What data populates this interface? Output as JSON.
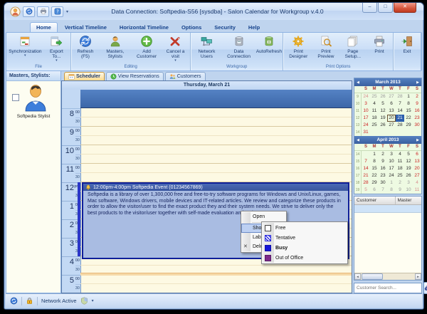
{
  "window": {
    "title": "Data Connection: Softpedia-S56 [sysdba] - Salon Calendar for Workgroup v.4.0",
    "controls": {
      "minimize": "–",
      "maximize": "□",
      "close": "✕"
    }
  },
  "ribbon": {
    "tabs": [
      {
        "label": "Home",
        "active": true
      },
      {
        "label": "Vertical Timeline"
      },
      {
        "label": "Horizontal Timeline"
      },
      {
        "label": "Options"
      },
      {
        "label": "Security"
      },
      {
        "label": "Help"
      }
    ],
    "groups": [
      {
        "label": "File",
        "buttons": [
          {
            "label": "Synchronization",
            "icon": "sync",
            "arrow": true
          },
          {
            "label": "Export To...",
            "icon": "export",
            "arrow": true
          }
        ]
      },
      {
        "label": "Editing",
        "buttons": [
          {
            "label": "Refresh (F5)",
            "icon": "refresh"
          },
          {
            "label": "Masters, Stylists",
            "icon": "masters"
          },
          {
            "label": "Add Customer",
            "icon": "add-customer"
          },
          {
            "label": "Cancel a visit",
            "icon": "cancel-visit",
            "arrow": true
          }
        ]
      },
      {
        "label": "Workgroup",
        "buttons": [
          {
            "label": "Network Users",
            "icon": "network-users"
          },
          {
            "label": "Data Connection",
            "icon": "data-connection"
          },
          {
            "label": "AutoRefresh",
            "icon": "autorefresh"
          }
        ]
      },
      {
        "label": "Print Options",
        "buttons": [
          {
            "label": "Print Designer",
            "icon": "print-designer"
          },
          {
            "label": "Print Preview",
            "icon": "print-preview"
          },
          {
            "label": "Page Setup...",
            "icon": "page-setup"
          },
          {
            "label": "Print",
            "icon": "print"
          }
        ]
      },
      {
        "label": "",
        "buttons": [
          {
            "label": "Exit",
            "icon": "exit"
          }
        ]
      }
    ]
  },
  "sidebar": {
    "header": "Masters, Stylists:",
    "stylist_name": "Softpedia Stylist"
  },
  "main_tabs": [
    {
      "label": "Scheduler",
      "icon": "tab-scheduler",
      "active": true
    },
    {
      "label": "View Reservations",
      "icon": "tab-reservations"
    },
    {
      "label": "Customers",
      "icon": "tab-customers"
    }
  ],
  "scheduler": {
    "day_header": "Thursday, March 21",
    "half_label": "30",
    "hours": [
      {
        "big": "8",
        "small": "00"
      },
      {
        "big": "9",
        "small": "00"
      },
      {
        "big": "10",
        "small": "00"
      },
      {
        "big": "11",
        "small": "00"
      },
      {
        "big": "12",
        "small": "pm"
      },
      {
        "big": "1",
        "small": "00"
      },
      {
        "big": "2",
        "small": "00"
      },
      {
        "big": "3",
        "small": "00"
      },
      {
        "big": "4",
        "small": "00"
      },
      {
        "big": "5",
        "small": "00"
      }
    ],
    "event": {
      "title": "12:00pm-4:00pm Softpedia Event (01234567869)",
      "body": "Softpedia is a library of over 1,300,000 free and free-to-try software programs for Windows and Unix/Linux, games, Mac software, Windows drivers, mobile devices and IT-related articles. We review and categorize these products in order to allow the visitor/user to find the exact product they and their system needs. We strive to deliver only the best products to the visitor/user together with self-made evaluation and review notes."
    }
  },
  "context_menu": {
    "items": [
      {
        "label": "Open",
        "separator_after": true
      },
      {
        "label": "Show Time As",
        "submenu": true,
        "highlighted": true
      },
      {
        "label": "Label",
        "submenu": true
      },
      {
        "label": "Delete",
        "icon": "delete-x"
      }
    ]
  },
  "show_time_as_menu": {
    "items": [
      {
        "label": "Free",
        "swatch": "free"
      },
      {
        "label": "Tentative",
        "swatch": "tentative"
      },
      {
        "label": "Busy",
        "swatch": "busy",
        "bold": true
      },
      {
        "label": "Out of Office",
        "swatch": "oof"
      }
    ]
  },
  "calendars": [
    {
      "title": "March 2013",
      "dows": [
        "S",
        "M",
        "T",
        "W",
        "T",
        "F",
        "S"
      ],
      "weeks": [
        {
          "wk": "9",
          "days": [
            {
              "n": 24,
              "out": true
            },
            {
              "n": 25,
              "out": true
            },
            {
              "n": 26,
              "out": true
            },
            {
              "n": 27,
              "out": true
            },
            {
              "n": 28,
              "out": true
            },
            {
              "n": 1
            },
            {
              "n": 2
            }
          ]
        },
        {
          "wk": "10",
          "days": [
            {
              "n": 3
            },
            {
              "n": 4
            },
            {
              "n": 5
            },
            {
              "n": 6
            },
            {
              "n": 7
            },
            {
              "n": 8
            },
            {
              "n": 9
            }
          ]
        },
        {
          "wk": "11",
          "days": [
            {
              "n": 10
            },
            {
              "n": 11
            },
            {
              "n": 12
            },
            {
              "n": 13
            },
            {
              "n": 14
            },
            {
              "n": 15
            },
            {
              "n": 16
            }
          ]
        },
        {
          "wk": "12",
          "days": [
            {
              "n": 17
            },
            {
              "n": 18
            },
            {
              "n": 19
            },
            {
              "n": 20,
              "today": true
            },
            {
              "n": 21,
              "sel": true
            },
            {
              "n": 22
            },
            {
              "n": 23
            }
          ]
        },
        {
          "wk": "13",
          "days": [
            {
              "n": 24
            },
            {
              "n": 25
            },
            {
              "n": 26
            },
            {
              "n": 27
            },
            {
              "n": 28
            },
            {
              "n": 29
            },
            {
              "n": 30
            }
          ]
        },
        {
          "wk": "14",
          "days": [
            {
              "n": 31
            },
            null,
            null,
            null,
            null,
            null,
            null
          ]
        }
      ]
    },
    {
      "title": "April 2013",
      "dows": [
        "S",
        "M",
        "T",
        "W",
        "T",
        "F",
        "S"
      ],
      "weeks": [
        {
          "wk": "14",
          "days": [
            null,
            {
              "n": 1
            },
            {
              "n": 2
            },
            {
              "n": 3
            },
            {
              "n": 4
            },
            {
              "n": 5
            },
            {
              "n": 6
            }
          ]
        },
        {
          "wk": "15",
          "days": [
            {
              "n": 7
            },
            {
              "n": 8
            },
            {
              "n": 9
            },
            {
              "n": 10
            },
            {
              "n": 11
            },
            {
              "n": 12
            },
            {
              "n": 13
            }
          ]
        },
        {
          "wk": "16",
          "days": [
            {
              "n": 14
            },
            {
              "n": 15
            },
            {
              "n": 16
            },
            {
              "n": 17
            },
            {
              "n": 18
            },
            {
              "n": 19
            },
            {
              "n": 20
            }
          ]
        },
        {
          "wk": "17",
          "days": [
            {
              "n": 21
            },
            {
              "n": 22
            },
            {
              "n": 23
            },
            {
              "n": 24
            },
            {
              "n": 25
            },
            {
              "n": 26
            },
            {
              "n": 27
            }
          ]
        },
        {
          "wk": "18",
          "days": [
            {
              "n": 28
            },
            {
              "n": 29
            },
            {
              "n": 30
            },
            {
              "n": 1,
              "out": true
            },
            {
              "n": 2,
              "out": true
            },
            {
              "n": 3,
              "out": true
            },
            {
              "n": 4,
              "out": true
            }
          ]
        },
        {
          "wk": "19",
          "days": [
            {
              "n": 5,
              "out": true
            },
            {
              "n": 6,
              "out": true
            },
            {
              "n": 7,
              "out": true
            },
            {
              "n": 8,
              "out": true
            },
            {
              "n": 9,
              "out": true
            },
            {
              "n": 10,
              "out": true
            },
            {
              "n": 11,
              "out": true
            }
          ]
        }
      ]
    }
  ],
  "customer_panel": {
    "columns": [
      "Customer",
      "Master"
    ],
    "search_placeholder": "Customer Search..."
  },
  "status_bar": {
    "network_text": "Network Active"
  },
  "colors": {
    "busy": "#1515d8",
    "tentative": "#2a2ae0",
    "out_of_office": "#7c2a8a",
    "free": "#ffffff",
    "selection_blue": "#2d5fae",
    "weekend_red": "#cc2222",
    "event_body": "#a9bce2",
    "event_border": "#0f1f99"
  }
}
